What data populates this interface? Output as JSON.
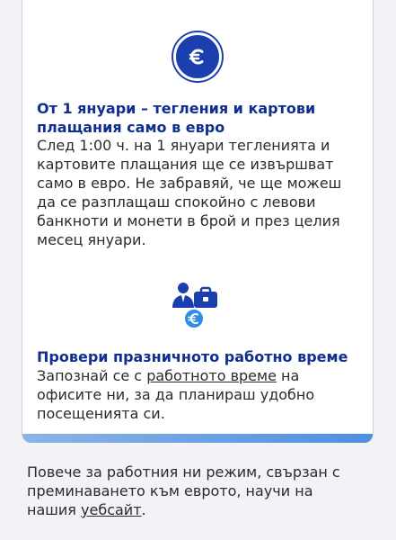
{
  "colors": {
    "accent": "#0f2f8f",
    "icon_blue": "#1b3fae",
    "icon_light_blue": "#2f8fe8",
    "border": "#c7d1e6",
    "text": "#2b2b2b"
  },
  "sections": [
    {
      "icon": "euro-coin-icon",
      "title": "От 1 януари – тегления и картови плащания само в евро",
      "body": "След 1:00 ч. на 1 януари тегленията и картовите плащания ще се извършват само в евро. Не забравяй, че ще можеш да се разплащаш спокойно с левови банкноти и монети в брой и през целия месец януари."
    },
    {
      "icon": "office-hours-icon",
      "title": "Провери празничното работно време",
      "body_before": "Запознай се с ",
      "body_link": "работното време",
      "body_after": " на офисите ни, за да планираш удобно посещенията си."
    }
  ],
  "footer": {
    "before": "Повече за работния ни режим, свързан с преминаването към еврото, научи на нашия ",
    "link": "уебсайт",
    "after": "."
  }
}
